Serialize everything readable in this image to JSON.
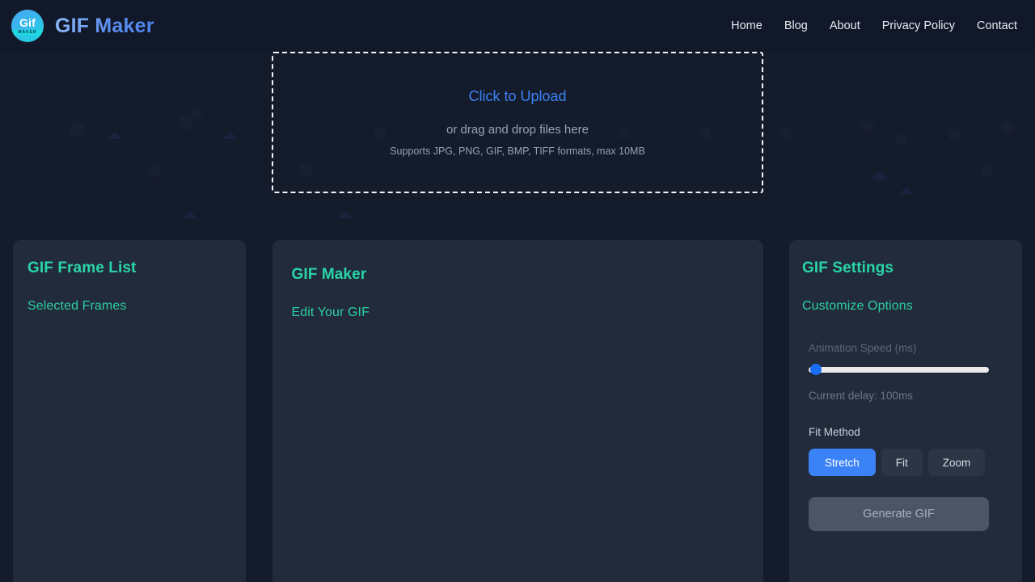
{
  "header": {
    "logo": {
      "text": "Gif",
      "subtext": "MAKER",
      "icon": "gif-logo-icon"
    },
    "title": "GIF Maker",
    "nav": [
      {
        "label": "Home"
      },
      {
        "label": "Blog"
      },
      {
        "label": "About"
      },
      {
        "label": "Privacy Policy"
      },
      {
        "label": "Contact"
      }
    ]
  },
  "upload": {
    "title": "Click to Upload",
    "subtitle": "or drag and drop files here",
    "formats": "Supports JPG, PNG, GIF, BMP, TIFF formats, max 10MB"
  },
  "frames_panel": {
    "title": "GIF Frame List",
    "subtitle": "Selected Frames"
  },
  "maker_panel": {
    "title": "GIF Maker",
    "subtitle": "Edit Your GIF"
  },
  "settings_panel": {
    "title": "GIF Settings",
    "subtitle": "Customize Options",
    "speed_label": "Animation Speed (ms)",
    "speed_value": 100,
    "delay_readout": "Current delay: 100ms",
    "fit_method_label": "Fit Method",
    "fit_methods": [
      {
        "label": "Stretch",
        "active": true
      },
      {
        "label": "Fit",
        "active": false
      },
      {
        "label": "Zoom",
        "active": false
      }
    ],
    "generate_label": "Generate GIF",
    "generate_disabled": true
  },
  "colors": {
    "page_bg": "#141b2b",
    "header_bg": "#101829",
    "panel_bg": "#212b3b",
    "accent_blue": "#3b82f6",
    "accent_teal": "#2ad4a8",
    "link_blue": "#3b82f6",
    "disabled_btn": "#4b5565"
  }
}
